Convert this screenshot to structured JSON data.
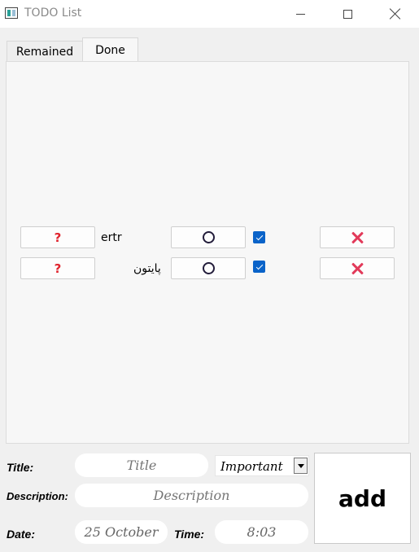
{
  "window": {
    "title": "TODO List"
  },
  "tabs": [
    {
      "label": "Remained"
    },
    {
      "label": "Done"
    }
  ],
  "tasks": [
    {
      "title": "ertr",
      "completed": true
    },
    {
      "title": "پایتون",
      "completed": true
    }
  ],
  "icons": {
    "details": "question-mark-icon",
    "status": "circle-icon",
    "delete": "close-x-icon",
    "colors": {
      "details": "#e0242e",
      "delete": "#e23a5a",
      "checkbox": "#0a63c9"
    }
  },
  "form": {
    "title_label": "Title:",
    "title_placeholder": "Title",
    "priority_value": "Important",
    "description_label": "Description:",
    "description_placeholder": "Description",
    "date_label": "Date:",
    "date_value": "25 October",
    "time_label": "Time:",
    "time_value": "8:03",
    "add_label": "add"
  }
}
